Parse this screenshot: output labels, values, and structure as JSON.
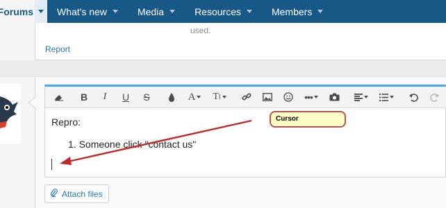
{
  "nav": {
    "forums": "Forums",
    "items": [
      {
        "label": "What's new"
      },
      {
        "label": "Media"
      },
      {
        "label": "Resources"
      },
      {
        "label": "Members"
      }
    ]
  },
  "previous_post": {
    "trailing_text": "used.",
    "report_link": "Report"
  },
  "editor": {
    "toolbar_icons": [
      "eraser-icon",
      "bold-icon",
      "italic-icon",
      "underline-icon",
      "strikethrough-icon",
      "text-color-icon",
      "font-size-icon",
      "text-style-icon",
      "link-icon",
      "image-icon",
      "smilie-icon",
      "more-options-icon",
      "camera-icon",
      "align-icon",
      "list-icon",
      "undo-icon",
      "redo-icon",
      "save-draft-icon"
    ],
    "content": {
      "paragraph": "Repro:",
      "list_item": "1. Someone click \"contact us\""
    }
  },
  "attach_button": "Attach files",
  "annotation": {
    "label": "Cursor",
    "color": "#c0504d"
  }
}
